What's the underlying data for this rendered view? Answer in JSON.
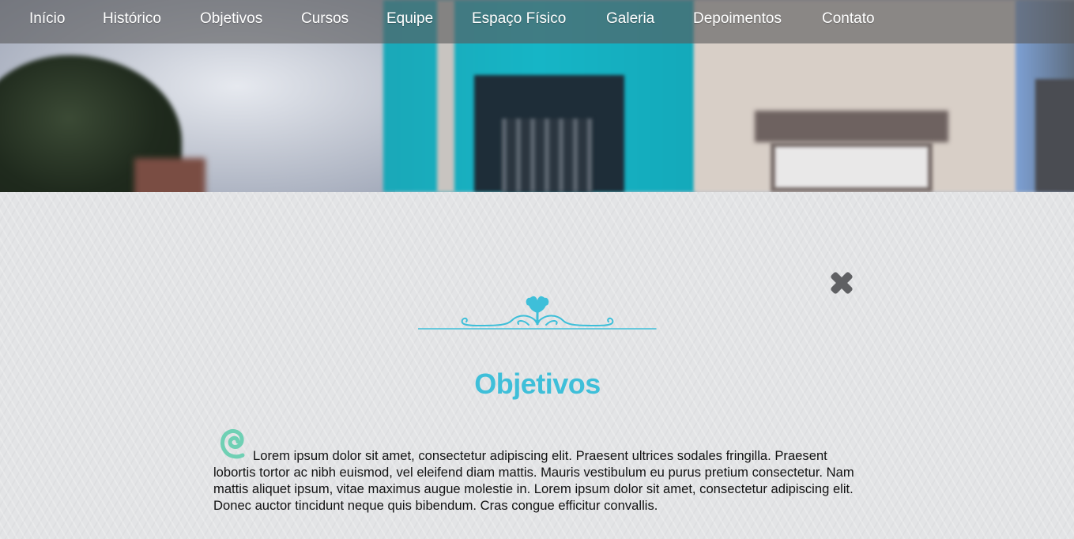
{
  "navbar": {
    "items": [
      {
        "label": "Início"
      },
      {
        "label": "Histórico"
      },
      {
        "label": "Objetivos"
      },
      {
        "label": "Cursos"
      },
      {
        "label": "Equipe"
      },
      {
        "label": "Espaço Físico"
      },
      {
        "label": "Galeria"
      },
      {
        "label": "Depoimentos"
      },
      {
        "label": "Contato"
      }
    ]
  },
  "modal": {
    "title": "Objetivos",
    "paragraph": "Lorem ipsum dolor sit amet, consectetur adipiscing elit. Praesent ultrices sodales fringilla. Praesent lobortis tortor ac nibh euismod, vel eleifend diam mattis. Mauris vestibulum eu purus pretium consectetur. Nam mattis aliquet ipsum, vitae maximus augue molestie in. Lorem ipsum dolor sit amet, consectetur adipiscing elit. Donec auctor tincidunt neque quis bibendum. Cras congue efficitur convallis."
  },
  "icons": {
    "close": "close-icon",
    "ornament": "ornament-divider-icon",
    "swirl": "swirl-icon"
  },
  "colors": {
    "accent": "#3ebfd9",
    "swirl": "#6fd0b4",
    "navbar_bg": "rgba(90,90,92,0.62)",
    "text": "#111111",
    "background": "#e3e4e6"
  }
}
